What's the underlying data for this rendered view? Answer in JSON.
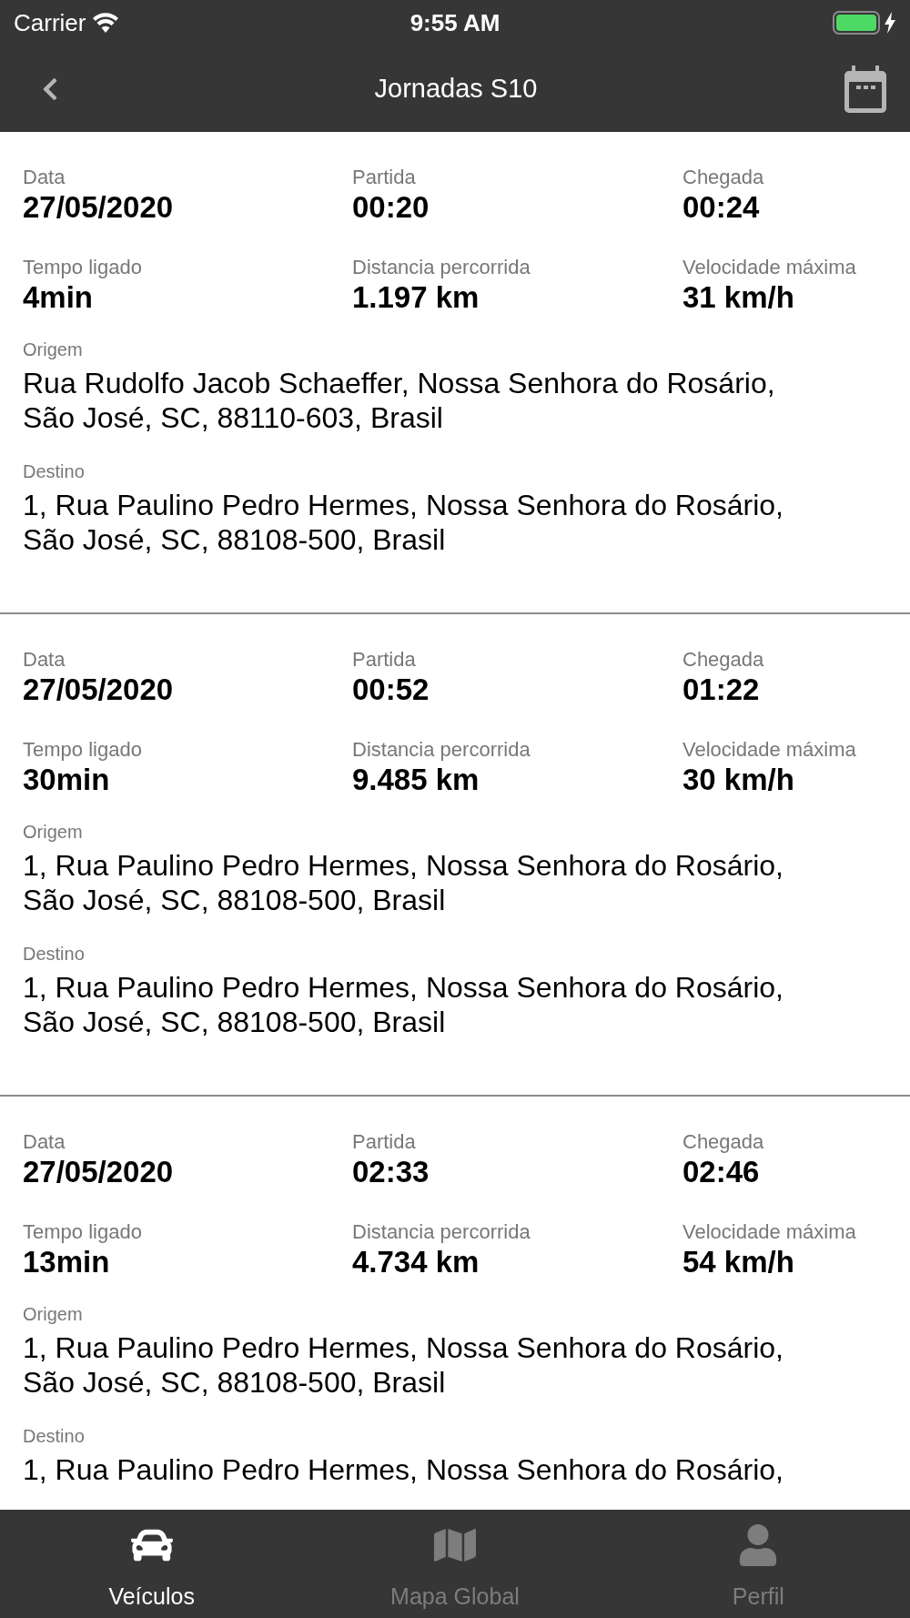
{
  "status_bar": {
    "carrier": "Carrier",
    "time": "9:55 AM",
    "charging": true
  },
  "nav_bar": {
    "title": "Jornadas S10"
  },
  "trips": [
    {
      "fields": [
        {
          "label": "Data",
          "value": "27/05/2020"
        },
        {
          "label": "Partida",
          "value": "00:20"
        },
        {
          "label": "Chegada",
          "value": "00:24"
        },
        {
          "label": "Tempo ligado",
          "value": "4min"
        },
        {
          "label": "Distancia percorrida",
          "value": "1.197 km"
        },
        {
          "label": "Velocidade máxima",
          "value": "31 km/h"
        }
      ],
      "origin": {
        "label": "Origem",
        "lines": [
          "Rua Rudolfo Jacob Schaeffer, Nossa Senhora do Rosário,",
          "São José, SC, 88110-603, Brasil"
        ]
      },
      "destination": {
        "label": "Destino",
        "lines": [
          "1, Rua Paulino Pedro Hermes, Nossa Senhora do Rosário,",
          "São José, SC, 88108-500, Brasil"
        ]
      }
    },
    {
      "fields": [
        {
          "label": "Data",
          "value": "27/05/2020"
        },
        {
          "label": "Partida",
          "value": "00:52"
        },
        {
          "label": "Chegada",
          "value": "01:22"
        },
        {
          "label": "Tempo ligado",
          "value": "30min"
        },
        {
          "label": "Distancia percorrida",
          "value": "9.485 km"
        },
        {
          "label": "Velocidade máxima",
          "value": "30 km/h"
        }
      ],
      "origin": {
        "label": "Origem",
        "lines": [
          "1, Rua Paulino Pedro Hermes, Nossa Senhora do Rosário,",
          "São José, SC, 88108-500, Brasil"
        ]
      },
      "destination": {
        "label": "Destino",
        "lines": [
          "1, Rua Paulino Pedro Hermes, Nossa Senhora do Rosário,",
          "São José, SC, 88108-500, Brasil"
        ]
      }
    },
    {
      "fields": [
        {
          "label": "Data",
          "value": "27/05/2020"
        },
        {
          "label": "Partida",
          "value": "02:33"
        },
        {
          "label": "Chegada",
          "value": "02:46"
        },
        {
          "label": "Tempo ligado",
          "value": "13min"
        },
        {
          "label": "Distancia percorrida",
          "value": "4.734 km"
        },
        {
          "label": "Velocidade máxima",
          "value": "54 km/h"
        }
      ],
      "origin": {
        "label": "Origem",
        "lines": [
          "1, Rua Paulino Pedro Hermes, Nossa Senhora do Rosário,",
          "São José, SC, 88108-500, Brasil"
        ]
      },
      "destination": {
        "label": "Destino",
        "lines": [
          "1, Rua Paulino Pedro Hermes, Nossa Senhora do Rosário,"
        ]
      }
    }
  ],
  "tabs": [
    {
      "kind": "car",
      "label": "Veículos",
      "selected": true
    },
    {
      "kind": "map",
      "label": "Mapa Global",
      "selected": false
    },
    {
      "kind": "person",
      "label": "Perfil",
      "selected": false
    }
  ]
}
